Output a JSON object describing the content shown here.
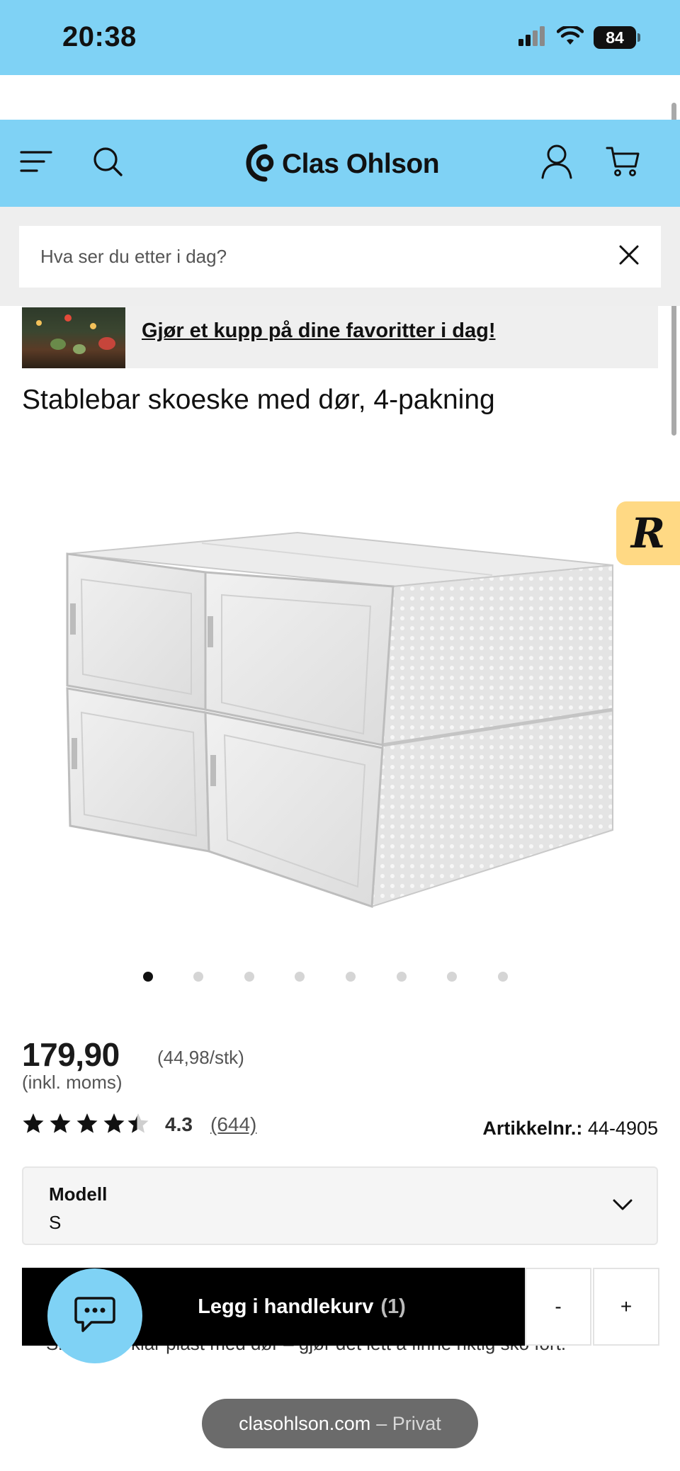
{
  "status_bar": {
    "time": "20:38",
    "battery": "84"
  },
  "header": {
    "brand": "Clas Ohlson",
    "icons": [
      "menu-icon",
      "search-icon",
      "account-icon",
      "cart-icon"
    ]
  },
  "search": {
    "placeholder": "Hva ser du etter i dag?"
  },
  "promo": {
    "link_text": "Gjør et kupp på dine favoritter i dag!"
  },
  "product": {
    "title": "Stablebar skoeske med dør, 4-pakning",
    "image_count": 8,
    "active_image": 1,
    "price": "179,90",
    "unit_price": "(44,98/stk)",
    "vat_note": "(inkl. moms)",
    "rating": "4.3",
    "rating_fraction": 0.86,
    "review_count": "(644)",
    "article_label": "Artikkelnr.:",
    "article_number": "44-4905",
    "description_visible": "Skoeske i klar plast med dør – gjør det lett å finne riktig sko fort."
  },
  "variant_select": {
    "label": "Modell",
    "value": "S"
  },
  "cart": {
    "add_label": "Legg i handlekurv",
    "quantity": "(1)",
    "minus_label": "-",
    "plus_label": "+"
  },
  "browser": {
    "domain": "clasohlson.com",
    "mode": "– Privat"
  },
  "colors": {
    "brand_blue": "#7fd2f5",
    "badge_yellow": "#ffd984",
    "button_black": "#000000"
  }
}
